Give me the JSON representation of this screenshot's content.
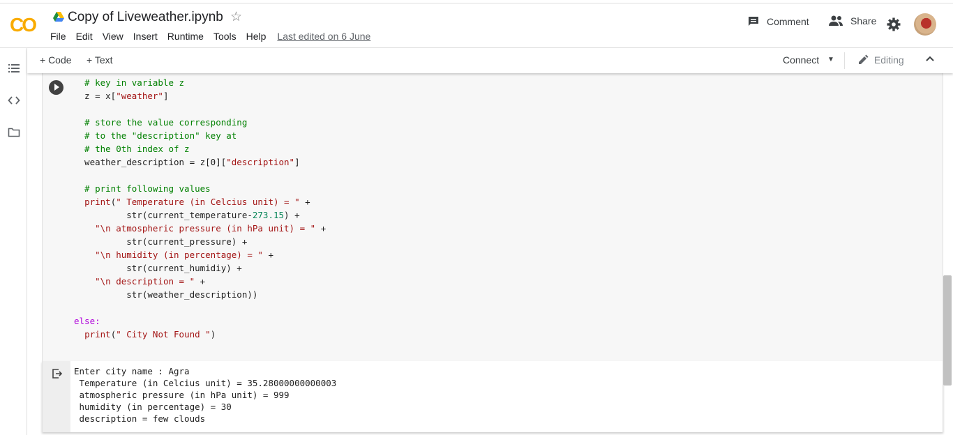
{
  "header": {
    "logo": "CO",
    "title": "Copy of Liveweather.ipynb",
    "menu": [
      "File",
      "Edit",
      "View",
      "Insert",
      "Runtime",
      "Tools",
      "Help"
    ],
    "last_edited": "Last edited on 6 June",
    "comment_label": "Comment",
    "share_label": "Share"
  },
  "toolbar": {
    "add_code": "+ Code",
    "add_text": "+ Text",
    "connect": "Connect",
    "editing": "Editing"
  },
  "cell": {
    "code_lines": [
      "  # key in variable z",
      "  z = x[\"weather\"]",
      "",
      "  # store the value corresponding",
      "  # to the \"description\" key at",
      "  # the 0th index of z",
      "  weather_description = z[0][\"description\"]",
      "",
      "  # print following values",
      "  print(\" Temperature (in Celcius unit) = \" +",
      "          str(current_temperature-273.15) +",
      "    \"\\n atmospheric pressure (in hPa unit) = \" +",
      "          str(current_pressure) +",
      "    \"\\n humidity (in percentage) = \" +",
      "          str(current_humidiy) +",
      "    \"\\n description = \" +",
      "          str(weather_description))",
      "",
      "else:",
      "  print(\" City Not Found \")"
    ]
  },
  "output": {
    "lines": [
      "Enter city name : Agra",
      " Temperature (in Celcius unit) = 35.28000000000003",
      " atmospheric pressure (in hPa unit) = 999",
      " humidity (in percentage) = 30",
      " description = few clouds"
    ]
  },
  "colors": {
    "logo": "#f9ab00",
    "comment": "#008000",
    "string": "#a31515",
    "keyword": "#af00db"
  }
}
